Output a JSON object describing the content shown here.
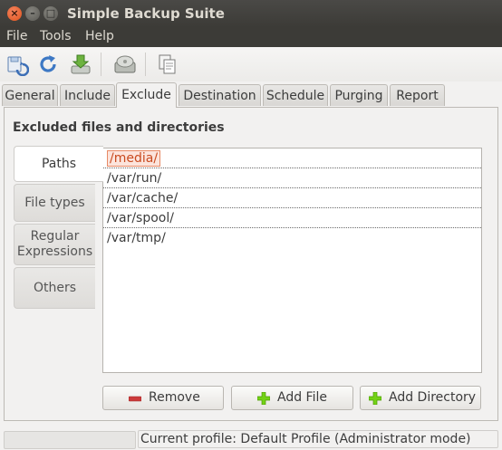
{
  "window": {
    "title": "Simple Backup Suite"
  },
  "menu": [
    "File",
    "Tools",
    "Help"
  ],
  "toolbar": {
    "icons": [
      "save-config-icon",
      "refresh-icon",
      "download-backup-icon",
      "hard-disk-icon",
      "copy-icon"
    ]
  },
  "tabs": [
    "General",
    "Include",
    "Exclude",
    "Destination",
    "Schedule",
    "Purging",
    "Report"
  ],
  "active_tab": "Exclude",
  "section_title": "Excluded files and directories",
  "subtabs": {
    "paths": "Paths",
    "file_types": "File types",
    "regex_line1": "Regular",
    "regex_line2": "Expressions",
    "others": "Others"
  },
  "paths": [
    "/media/",
    "/var/run/",
    "/var/cache/",
    "/var/spool/",
    "/var/tmp/"
  ],
  "buttons": {
    "remove": "Remove",
    "add_file": "Add File",
    "add_directory": "Add Directory"
  },
  "status": {
    "text": "Current profile: Default Profile  (Administrator mode)"
  },
  "colors": {
    "accent": "#e0541d",
    "add_icon": "#73d216",
    "remove_icon": "#cc3b3b"
  }
}
